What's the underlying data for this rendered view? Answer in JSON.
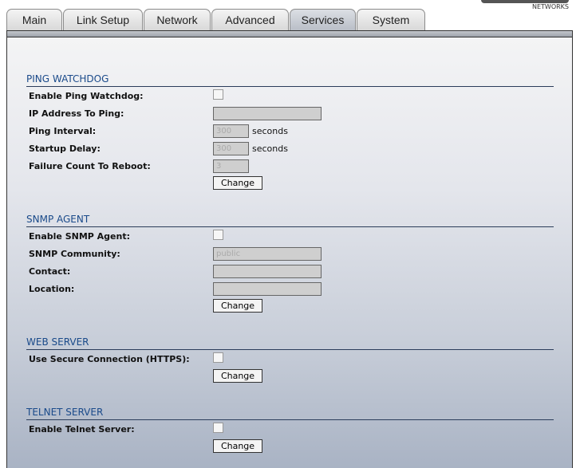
{
  "logo": {
    "text": "NETWORKS"
  },
  "tabs": [
    {
      "label": "Main"
    },
    {
      "label": "Link Setup"
    },
    {
      "label": "Network"
    },
    {
      "label": "Advanced"
    },
    {
      "label": "Services",
      "active": true
    },
    {
      "label": "System"
    }
  ],
  "ping": {
    "title": "PING WATCHDOG",
    "enable_label": "Enable Ping Watchdog:",
    "ip_label": "IP Address To Ping:",
    "ip_value": "",
    "interval_label": "Ping Interval:",
    "interval_value": "300",
    "interval_unit": "seconds",
    "delay_label": "Startup Delay:",
    "delay_value": "300",
    "delay_unit": "seconds",
    "failure_label": "Failure Count To Reboot:",
    "failure_value": "3",
    "change": "Change"
  },
  "snmp": {
    "title": "SNMP AGENT",
    "enable_label": "Enable SNMP Agent:",
    "community_label": "SNMP Community:",
    "community_value": "public",
    "contact_label": "Contact:",
    "contact_value": "",
    "location_label": "Location:",
    "location_value": "",
    "change": "Change"
  },
  "web": {
    "title": "WEB SERVER",
    "https_label": "Use Secure Connection (HTTPS):",
    "change": "Change"
  },
  "telnet": {
    "title": "TELNET SERVER",
    "enable_label": "Enable Telnet Server:",
    "change": "Change"
  }
}
